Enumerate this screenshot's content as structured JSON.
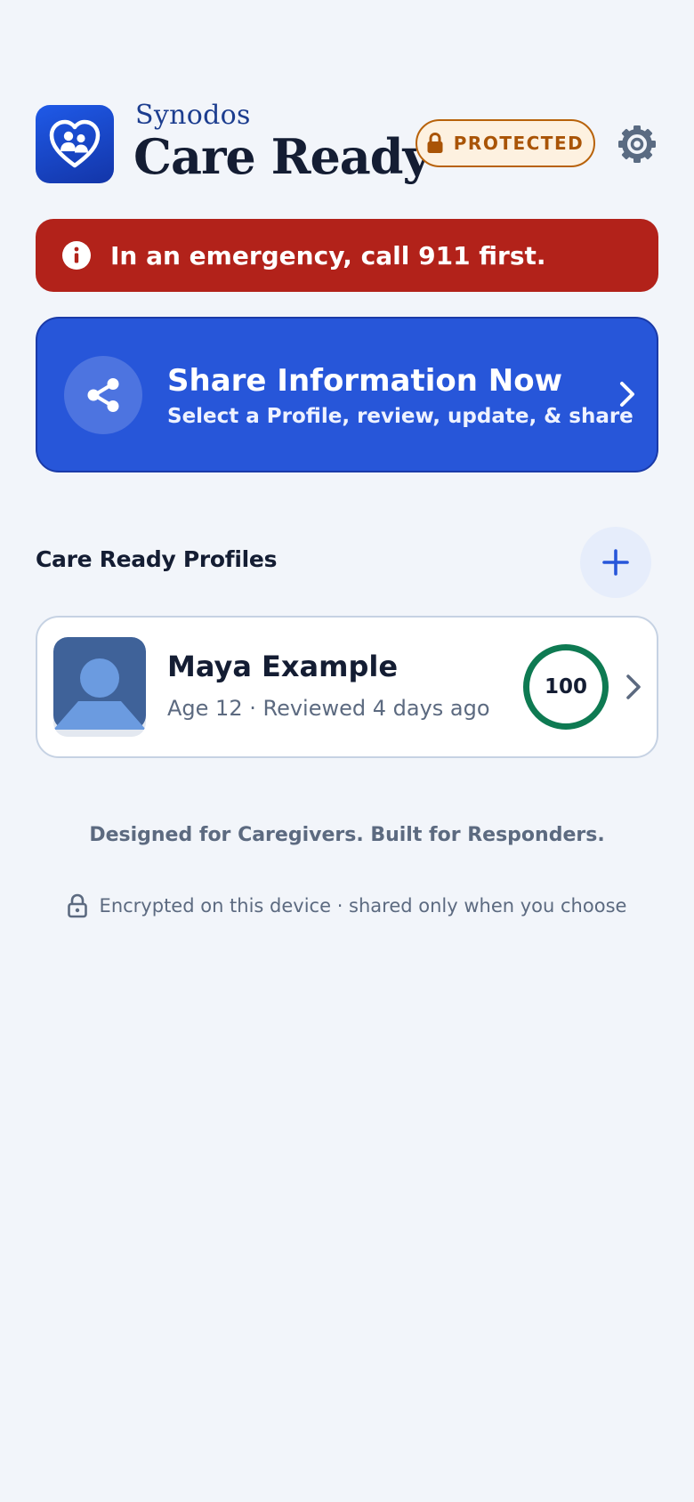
{
  "header": {
    "brand": "Synodos",
    "title": "Care Ready",
    "badge_label": "PROTECTED",
    "settings_icon": "gear-icon"
  },
  "emergency": {
    "icon": "info-icon",
    "text": "In an emergency, call 911 first."
  },
  "share": {
    "icon": "share-icon",
    "title": "Share Information Now",
    "subtitle": "Select a Profile, review, update, & share"
  },
  "profiles": {
    "section_label": "Care Ready Profiles",
    "add_icon": "plus-icon",
    "items": [
      {
        "name": "Maya Example",
        "meta": "Age 12 · Reviewed 4 days ago",
        "score": "100"
      }
    ]
  },
  "footer": {
    "tagline": "Designed for Caregivers. Built for Responders.",
    "encrypted": "Encrypted on this device · shared only when you choose"
  },
  "colors": {
    "background": "#f2f5fa",
    "emergency": "#b2221a",
    "share": "#2756d9",
    "protected": "#a95406",
    "score_ring": "#0e7a52"
  }
}
